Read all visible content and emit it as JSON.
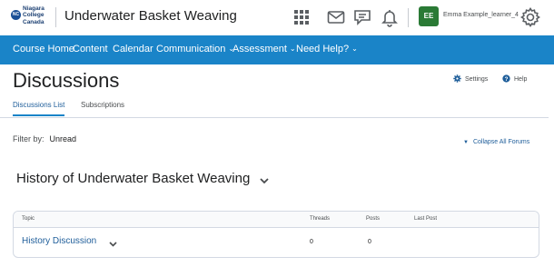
{
  "header": {
    "logo_badge": "NC",
    "logo_text": "Niagara College Canada",
    "course_title": "Underwater Basket Weaving",
    "user_initials": "EE",
    "user_name": "Emma Example_learner_4",
    "icons": [
      "grid-icon",
      "mail-icon",
      "chat-icon",
      "bell-icon",
      "gear-icon"
    ]
  },
  "nav": {
    "items": [
      {
        "label": "Course Home",
        "has_menu": false
      },
      {
        "label": "Content",
        "has_menu": false
      },
      {
        "label": "Calendar",
        "has_menu": false
      },
      {
        "label": "Communication",
        "has_menu": true
      },
      {
        "label": "Assessment",
        "has_menu": true
      },
      {
        "label": "Need Help?",
        "has_menu": true
      }
    ],
    "chevron": "⌄",
    "color": "#1a84c8"
  },
  "page": {
    "title": "Discussions",
    "settings_label": "Settings",
    "help_label": "Help",
    "tabs": [
      {
        "label": "Discussions List",
        "active": true
      },
      {
        "label": "Subscriptions",
        "active": false
      }
    ],
    "filter_label": "Filter by:",
    "filter_value": "Unread",
    "collapse_label": "Collapse All Forums"
  },
  "category": {
    "title": "History of Underwater Basket Weaving",
    "columns": [
      "Topic",
      "Threads",
      "Posts",
      "Last Post"
    ],
    "topics": [
      {
        "name": "History Discussion",
        "threads": "0",
        "posts": "0",
        "last_post": ""
      }
    ]
  },
  "colors": {
    "accent": "#1a84c8",
    "link": "#1f5e9a",
    "avatar": "#2a7a35"
  }
}
